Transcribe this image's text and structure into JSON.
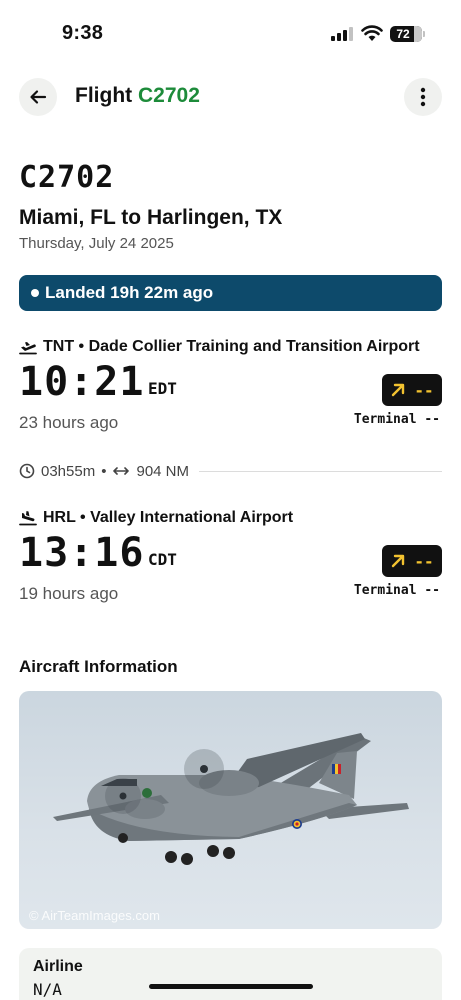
{
  "status_bar": {
    "time": "9:38",
    "battery": "72"
  },
  "header": {
    "title_prefix": "Flight",
    "title_code": "C2702"
  },
  "flight": {
    "code": "C2702",
    "route": "Miami, FL to Harlingen, TX",
    "date": "Thursday, July 24 2025",
    "status": "Landed 19h 22m ago"
  },
  "departure": {
    "airport": "TNT • Dade Collier Training and Transition Airport",
    "time": "10:21",
    "tz": "EDT",
    "relative": "23 hours ago",
    "gate": "--",
    "terminal": "Terminal --"
  },
  "duration": {
    "time": "03h55m",
    "separator": "•",
    "distance": "904 NM"
  },
  "arrival": {
    "airport": "HRL • Valley International Airport",
    "time": "13:16",
    "tz": "CDT",
    "relative": "19 hours ago",
    "gate": "--",
    "terminal": "Terminal --"
  },
  "aircraft": {
    "section_title": "Aircraft Information",
    "photo_credit": "© AirTeamImages.com"
  },
  "airline": {
    "label": "Airline",
    "value": "N/A"
  },
  "colors": {
    "accent_green": "#1d8b3a",
    "status_blue": "#0d4a6b",
    "gate_yellow": "#f2c230"
  }
}
